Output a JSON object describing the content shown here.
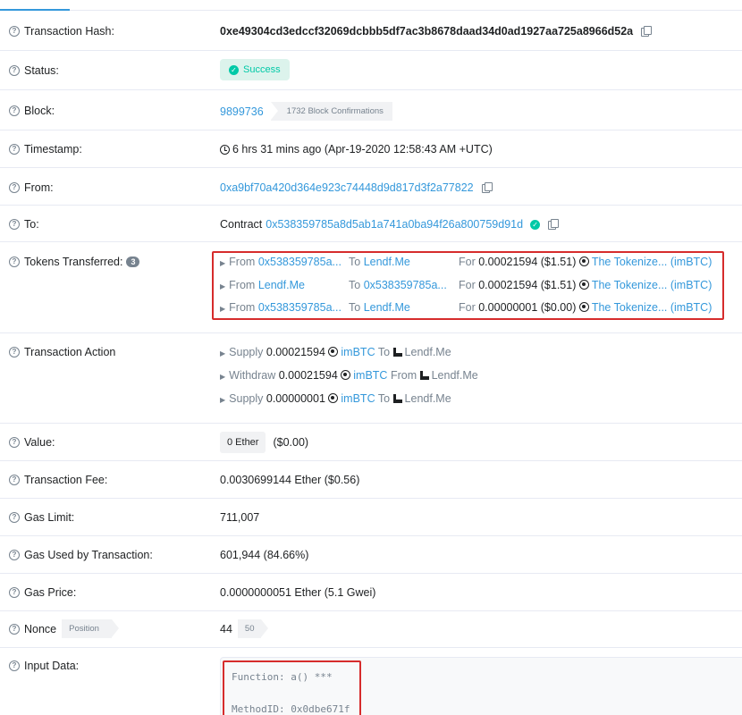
{
  "rows": {
    "hash": {
      "label": "Transaction Hash:",
      "value": "0xe49304cd3edccf32069dcbbb5df7ac3b8678daad34d0ad1927aa725a8966d52a"
    },
    "status": {
      "label": "Status:",
      "value": "Success"
    },
    "block": {
      "label": "Block:",
      "value": "9899736",
      "confirmations": "1732 Block Confirmations"
    },
    "timestamp": {
      "label": "Timestamp:",
      "value": "6 hrs 31 mins ago (Apr-19-2020 12:58:43 AM +UTC)"
    },
    "from": {
      "label": "From:",
      "value": "0xa9bf70a420d364e923c74448d9d817d3f2a77822"
    },
    "to": {
      "label": "To:",
      "prefix": "Contract",
      "value": "0x538359785a8d5ab1a741a0ba94f26a800759d91d"
    },
    "tokens": {
      "label": "Tokens Transferred:",
      "count": "3"
    },
    "action": {
      "label": "Transaction Action"
    },
    "value": {
      "label": "Value:",
      "ether": "0 Ether",
      "usd": "($0.00)"
    },
    "fee": {
      "label": "Transaction Fee:",
      "value": "0.0030699144 Ether ($0.56)"
    },
    "gas_limit": {
      "label": "Gas Limit:",
      "value": "711,007"
    },
    "gas_used": {
      "label": "Gas Used by Transaction:",
      "value": "601,944 (84.66%)"
    },
    "gas_price": {
      "label": "Gas Price:",
      "value": "0.0000000051 Ether (5.1 Gwei)"
    },
    "nonce": {
      "label": "Nonce",
      "position_tag": "Position",
      "value": "44",
      "position": "50"
    },
    "input": {
      "label": "Input Data:",
      "function": "Function: a() ***",
      "method": "MethodID: 0x0dbe671f"
    }
  },
  "transfers": [
    {
      "from_word": "From",
      "from": "0x538359785a...",
      "to_word": "To",
      "to": "Lendf.Me",
      "for_word": "For",
      "amount": "0.00021594 ($1.51)",
      "token": "The Tokenize... (imBTC)"
    },
    {
      "from_word": "From",
      "from": "Lendf.Me",
      "to_word": "To",
      "to": "0x538359785a...",
      "for_word": "For",
      "amount": "0.00021594 ($1.51)",
      "token": "The Tokenize... (imBTC)"
    },
    {
      "from_word": "From",
      "from": "0x538359785a...",
      "to_word": "To",
      "to": "Lendf.Me",
      "for_word": "For",
      "amount": "0.00000001 ($0.00)",
      "token": "The Tokenize... (imBTC)"
    }
  ],
  "actions": [
    {
      "verb": "Supply",
      "amount": "0.00021594",
      "token": "imBTC",
      "dir": "To",
      "target": "Lendf.Me"
    },
    {
      "verb": "Withdraw",
      "amount": "0.00021594",
      "token": "imBTC",
      "dir": "From",
      "target": "Lendf.Me"
    },
    {
      "verb": "Supply",
      "amount": "0.00000001",
      "token": "imBTC",
      "dir": "To",
      "target": "Lendf.Me"
    }
  ],
  "colors": {
    "link": "#3498db",
    "success": "#00c9a7",
    "highlight": "#d62c2c"
  }
}
